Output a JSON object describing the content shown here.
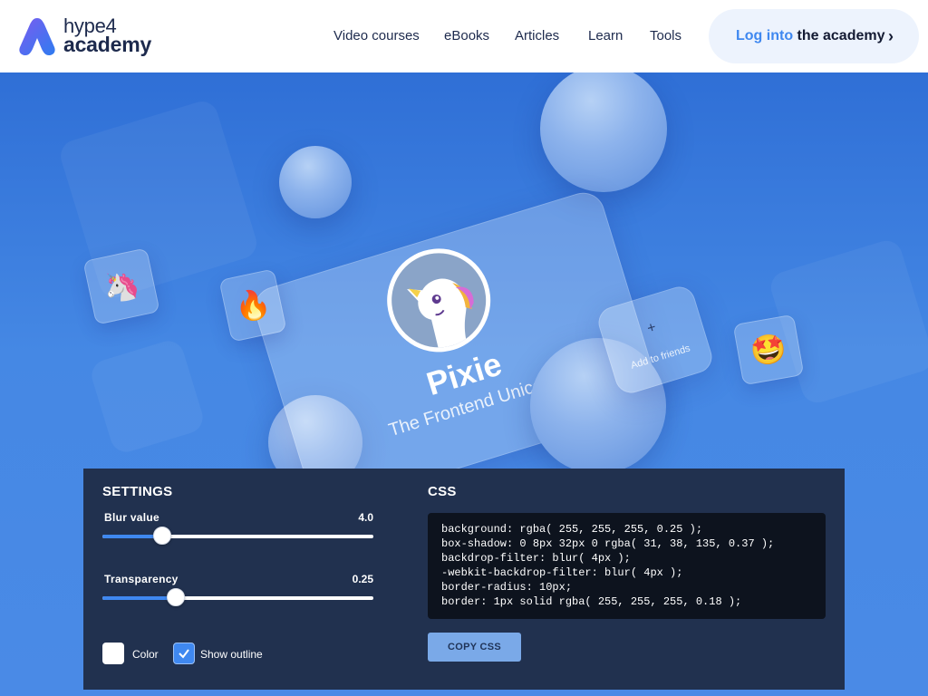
{
  "brand": {
    "line1": "hype4",
    "line2": "academy"
  },
  "nav": {
    "items": [
      {
        "label": "Video courses"
      },
      {
        "label": "eBooks"
      },
      {
        "label": "Articles"
      },
      {
        "label": "Learn"
      },
      {
        "label": "Tools"
      }
    ],
    "login": {
      "prefix": "Log into",
      "suffix": "the academy",
      "icon": "chevron-right-icon"
    }
  },
  "hero": {
    "card": {
      "name": "Pixie",
      "subtitle": "The Frontend Unicorn",
      "avatar_icon": "unicorn-avatar"
    },
    "friend_card": {
      "plus": "+",
      "label": "Add to friends"
    },
    "emoji_cards": [
      {
        "icon": "unicorn-emoji",
        "glyph": "🦄"
      },
      {
        "icon": "fire-emoji",
        "glyph": "🔥"
      },
      {
        "icon": "star-struck-emoji",
        "glyph": "🤩"
      }
    ]
  },
  "settings": {
    "title": "SETTINGS",
    "blur": {
      "label": "Blur value",
      "value": "4.0",
      "fraction": 0.22
    },
    "transparency": {
      "label": "Transparency",
      "value": "0.25",
      "fraction": 0.27
    },
    "color": {
      "label": "Color",
      "checked": false
    },
    "outline": {
      "label": "Show outline",
      "checked": true
    }
  },
  "css": {
    "title": "CSS",
    "lines": [
      "background: rgba( 255, 255, 255, 0.25 );",
      "box-shadow: 0 8px 32px 0 rgba( 31, 38, 135, 0.37 );",
      "backdrop-filter: blur( 4px );",
      "-webkit-backdrop-filter: blur( 4px );",
      "border-radius: 10px;",
      "border: 1px solid rgba( 255, 255, 255, 0.18 );"
    ],
    "copy_label": "COPY CSS"
  },
  "colors": {
    "accent": "#3f88f0",
    "panel": "#21314f",
    "code_bg": "#0d131e",
    "navy": "#1d2a4d"
  }
}
